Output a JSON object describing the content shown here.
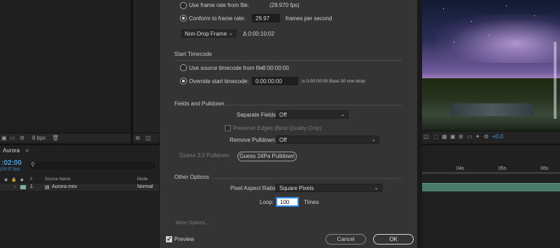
{
  "dialog": {
    "frame_rate": {
      "use_from_file_label": "Use frame rate from file:",
      "from_file_value": "(29.970 fps)",
      "conform_label": "Conform to frame rate:",
      "conform_value": "29.97",
      "fps_unit": "frames per second",
      "drop_frame_select": "Non-Drop Frame",
      "duration": "Δ 0:00:10:02"
    },
    "start_timecode": {
      "title": "Start Timecode",
      "use_source_label": "Use source timecode from file:",
      "use_source_value": "0:00:00:00",
      "override_label": "Override start timecode:",
      "override_value": "0:00:00:00",
      "override_info": "is 0:00:00:00  Base 30  non-drop"
    },
    "fields_pulldown": {
      "title": "Fields and Pulldown",
      "separate_fields_label": "Separate Fields:",
      "separate_fields_value": "Off",
      "preserve_edges_label": "Preserve Edges (Best Quality Only)",
      "remove_pulldown_label": "Remove Pulldown:",
      "remove_pulldown_value": "Off",
      "guess_32": "Guess 3:2 Pulldown",
      "guess_24pa": "Guess 24Pa Pulldown"
    },
    "other_options": {
      "title": "Other Options",
      "par_label": "Pixel Aspect Ratio:",
      "par_value": "Square Pixels",
      "loop_label": "Loop:",
      "loop_value": "100",
      "loop_unit": "Times"
    },
    "more_options": "More Options...",
    "preview_label": "Preview",
    "cancel": "Cancel",
    "ok": "OK"
  },
  "project_bar": {
    "bpc": "8 bpc"
  },
  "timeline": {
    "tab": "Aurora",
    "timecode": ":02:00",
    "fps": "(29.97 fps)",
    "search_icon": "search-icon",
    "columns": {
      "hash": "#",
      "source_name": "Source Name",
      "mode": "Mode"
    },
    "layer": {
      "index": "1",
      "name": "Aurora.mov",
      "mode": "Normal"
    },
    "ruler": [
      "04s",
      "05s",
      "06s"
    ]
  },
  "viewer": {
    "exposure": "+0.0"
  },
  "colors": {
    "timecode_blue": "#3fa0e8",
    "layer_green": "#4a7a68",
    "focus_blue": "#2d8ceb"
  }
}
